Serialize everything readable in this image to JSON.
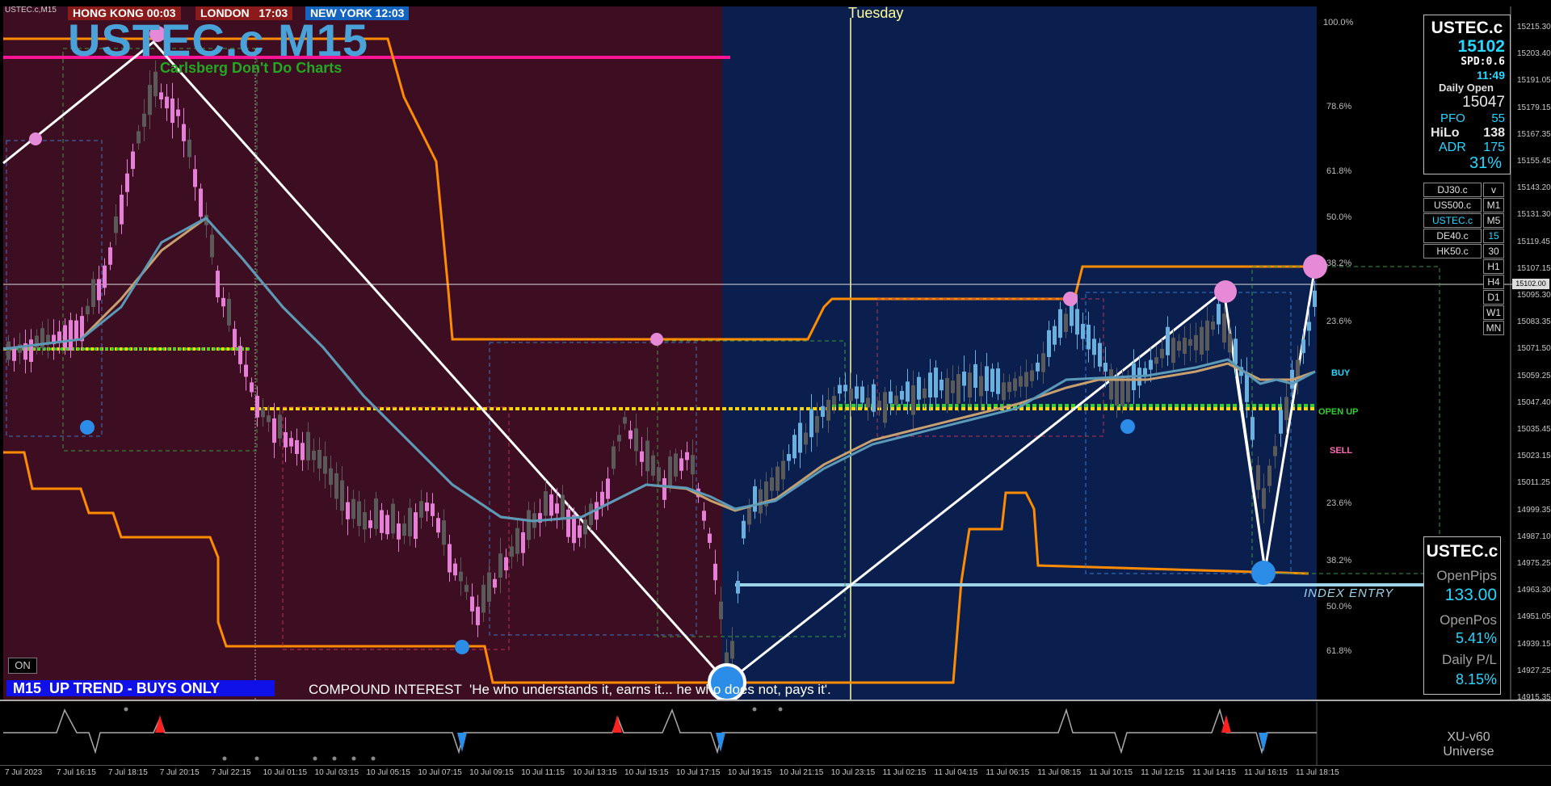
{
  "chart_label": "USTEC.c,M15",
  "sessions": [
    {
      "label": "HONG KONG 00:03",
      "color": "#8b1a1a"
    },
    {
      "label": "LONDON   17:03",
      "color": "#8b1a1a"
    },
    {
      "label": "NEW YORK 12:03",
      "color": "#1565c0"
    }
  ],
  "day_label": "Tuesday",
  "big_title": "USTEC.c M15",
  "subtitle": "Carlsberg Don't Do Charts",
  "fib_labels_top": [
    "100.0%",
    "78.6%",
    "61.8%",
    "50.0%",
    "38.2%",
    "23.6%"
  ],
  "fib_labels_bottom": [
    "23.6%",
    "38.2%",
    "50.0%",
    "61.8%"
  ],
  "price_axis": [
    "15215.30",
    "15203.40",
    "15191.05",
    "15179.15",
    "15167.35",
    "15155.45",
    "15143.20",
    "15131.30",
    "15119.45",
    "15107.15",
    "15095.30",
    "15083.35",
    "15071.50",
    "15059.25",
    "15047.40",
    "15035.45",
    "15023.15",
    "15011.25",
    "14999.35",
    "14987.10",
    "14975.25",
    "14963.30",
    "14951.05",
    "14939.15",
    "14927.25",
    "14915.35"
  ],
  "current_price_tag": "15102.00",
  "signal_labels": {
    "buy": "BUY",
    "open_up": "OPEN UP",
    "sell": "SELL",
    "index_entry": "INDEX ENTRY"
  },
  "info_panel": {
    "symbol": "USTEC.c",
    "price": "15102",
    "spread": "SPD:0.6",
    "time": "11:49",
    "daily_open_label": "Daily Open",
    "daily_open": "15047",
    "pfo_label": "PFO",
    "pfo": "55",
    "hilo_label": "HiLo",
    "hilo": "138",
    "adr_label": "ADR",
    "adr": "175",
    "pct": "31%"
  },
  "symbol_buttons": [
    "DJ30.c",
    "US500.c",
    "USTEC.c",
    "DE40.c",
    "HK50.c"
  ],
  "timeframe_buttons": [
    "v",
    "M1",
    "M5",
    "15",
    "30",
    "H1",
    "H4",
    "D1",
    "W1",
    "MN"
  ],
  "pips_panel": {
    "symbol": "USTEC.c",
    "open_pips_label": "OpenPips",
    "open_pips": "133.00",
    "open_pos_label": "OpenPos",
    "open_pos": "5.41%",
    "daily_pl_label": "Daily P/L",
    "daily_pl": "8.15%"
  },
  "on_button": "ON",
  "trend_banner": "M15  UP TREND - BUYS ONLY",
  "quote": "COMPOUND INTEREST  'He who understands it, earns it... he who does not, pays it'.",
  "indicator_name_line1": "XU-v60",
  "indicator_name_line2": "Universe",
  "time_axis": [
    "7 Jul 2023",
    "7 Jul 16:15",
    "7 Jul 18:15",
    "7 Jul 20:15",
    "7 Jul 22:15",
    "10 Jul 01:15",
    "10 Jul 03:15",
    "10 Jul 05:15",
    "10 Jul 07:15",
    "10 Jul 09:15",
    "10 Jul 11:15",
    "10 Jul 13:15",
    "10 Jul 15:15",
    "10 Jul 17:15",
    "10 Jul 19:15",
    "10 Jul 21:15",
    "10 Jul 23:15",
    "11 Jul 02:15",
    "11 Jul 04:15",
    "11 Jul 06:15",
    "11 Jul 08:15",
    "11 Jul 10:15",
    "11 Jul 12:15",
    "11 Jul 14:15",
    "11 Jul 16:15",
    "11 Jul 18:15"
  ],
  "colors": {
    "bg_red": "#3d0d21",
    "bg_blue": "#0b1f4e",
    "orange": "#ff8c00",
    "accent_cyan": "#27d7ff",
    "magenta": "#ff1493"
  }
}
